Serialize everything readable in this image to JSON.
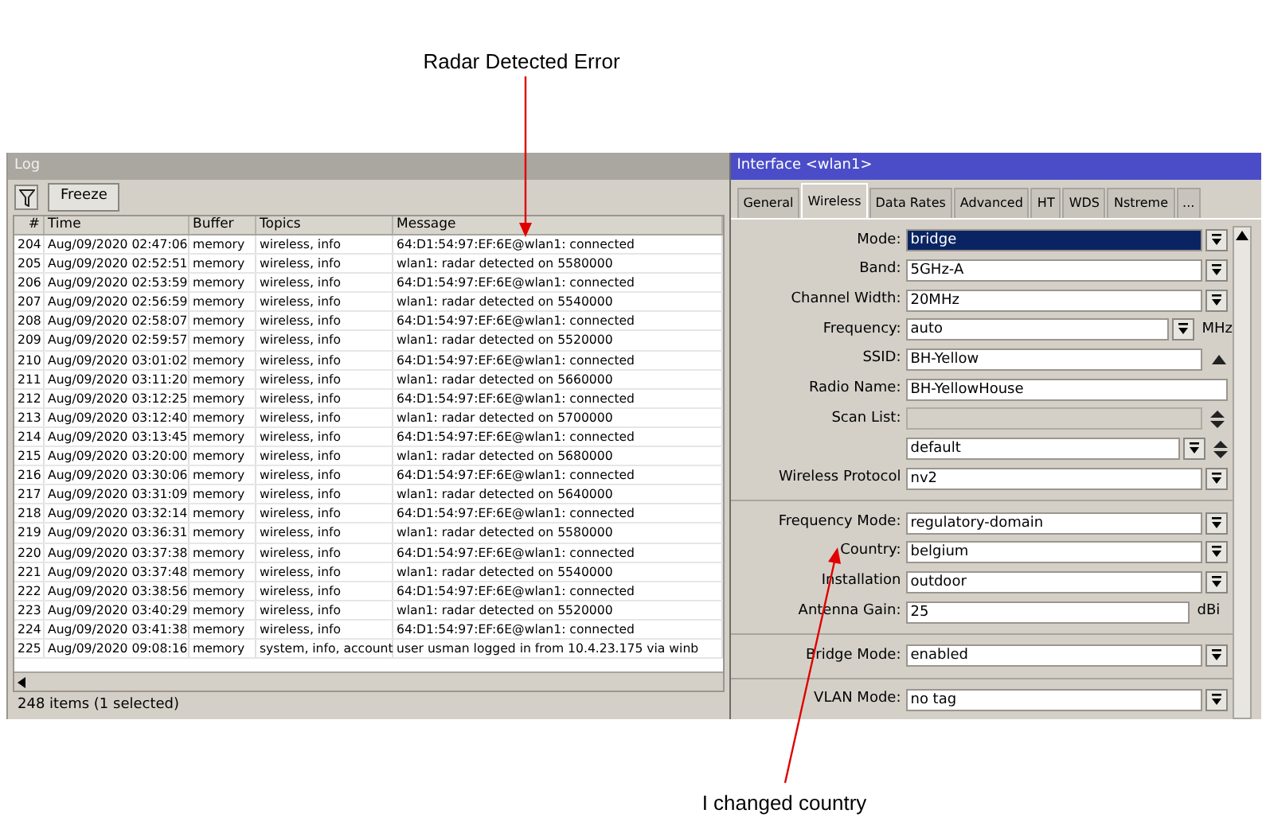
{
  "annotations": [
    {
      "text": "Radar Detected Error"
    },
    {
      "text": "I changed country"
    }
  ],
  "log": {
    "title": "Log",
    "freeze_button": "Freeze",
    "columns": [
      "#",
      "Time",
      "Buffer",
      "Topics",
      "Message"
    ],
    "rows": [
      {
        "n": "204",
        "time": "Aug/09/2020 02:47:06",
        "buffer": "memory",
        "topics": "wireless, info",
        "message": "64:D1:54:97:EF:6E@wlan1: connected"
      },
      {
        "n": "205",
        "time": "Aug/09/2020 02:52:51",
        "buffer": "memory",
        "topics": "wireless, info",
        "message": "wlan1: radar detected on 5580000"
      },
      {
        "n": "206",
        "time": "Aug/09/2020 02:53:59",
        "buffer": "memory",
        "topics": "wireless, info",
        "message": "64:D1:54:97:EF:6E@wlan1: connected"
      },
      {
        "n": "207",
        "time": "Aug/09/2020 02:56:59",
        "buffer": "memory",
        "topics": "wireless, info",
        "message": "wlan1: radar detected on 5540000"
      },
      {
        "n": "208",
        "time": "Aug/09/2020 02:58:07",
        "buffer": "memory",
        "topics": "wireless, info",
        "message": "64:D1:54:97:EF:6E@wlan1: connected"
      },
      {
        "n": "209",
        "time": "Aug/09/2020 02:59:57",
        "buffer": "memory",
        "topics": "wireless, info",
        "message": "wlan1: radar detected on 5520000"
      },
      {
        "n": "210",
        "time": "Aug/09/2020 03:01:02",
        "buffer": "memory",
        "topics": "wireless, info",
        "message": "64:D1:54:97:EF:6E@wlan1: connected"
      },
      {
        "n": "211",
        "time": "Aug/09/2020 03:11:20",
        "buffer": "memory",
        "topics": "wireless, info",
        "message": "wlan1: radar detected on 5660000"
      },
      {
        "n": "212",
        "time": "Aug/09/2020 03:12:25",
        "buffer": "memory",
        "topics": "wireless, info",
        "message": "64:D1:54:97:EF:6E@wlan1: connected"
      },
      {
        "n": "213",
        "time": "Aug/09/2020 03:12:40",
        "buffer": "memory",
        "topics": "wireless, info",
        "message": "wlan1: radar detected on 5700000"
      },
      {
        "n": "214",
        "time": "Aug/09/2020 03:13:45",
        "buffer": "memory",
        "topics": "wireless, info",
        "message": "64:D1:54:97:EF:6E@wlan1: connected"
      },
      {
        "n": "215",
        "time": "Aug/09/2020 03:20:00",
        "buffer": "memory",
        "topics": "wireless, info",
        "message": "wlan1: radar detected on 5680000"
      },
      {
        "n": "216",
        "time": "Aug/09/2020 03:30:06",
        "buffer": "memory",
        "topics": "wireless, info",
        "message": "64:D1:54:97:EF:6E@wlan1: connected"
      },
      {
        "n": "217",
        "time": "Aug/09/2020 03:31:09",
        "buffer": "memory",
        "topics": "wireless, info",
        "message": "wlan1: radar detected on 5640000"
      },
      {
        "n": "218",
        "time": "Aug/09/2020 03:32:14",
        "buffer": "memory",
        "topics": "wireless, info",
        "message": "64:D1:54:97:EF:6E@wlan1: connected"
      },
      {
        "n": "219",
        "time": "Aug/09/2020 03:36:31",
        "buffer": "memory",
        "topics": "wireless, info",
        "message": "wlan1: radar detected on 5580000"
      },
      {
        "n": "220",
        "time": "Aug/09/2020 03:37:38",
        "buffer": "memory",
        "topics": "wireless, info",
        "message": "64:D1:54:97:EF:6E@wlan1: connected"
      },
      {
        "n": "221",
        "time": "Aug/09/2020 03:37:48",
        "buffer": "memory",
        "topics": "wireless, info",
        "message": "wlan1: radar detected on 5540000"
      },
      {
        "n": "222",
        "time": "Aug/09/2020 03:38:56",
        "buffer": "memory",
        "topics": "wireless, info",
        "message": "64:D1:54:97:EF:6E@wlan1: connected"
      },
      {
        "n": "223",
        "time": "Aug/09/2020 03:40:29",
        "buffer": "memory",
        "topics": "wireless, info",
        "message": "wlan1: radar detected on 5520000"
      },
      {
        "n": "224",
        "time": "Aug/09/2020 03:41:38",
        "buffer": "memory",
        "topics": "wireless, info",
        "message": "64:D1:54:97:EF:6E@wlan1: connected"
      },
      {
        "n": "225",
        "time": "Aug/09/2020 09:08:16",
        "buffer": "memory",
        "topics": "system, info, account",
        "message": "user usman logged in from 10.4.23.175 via winb"
      }
    ],
    "status": "248 items (1 selected)"
  },
  "interface": {
    "title": "Interface <wlan1>",
    "tabs": [
      {
        "label": "General",
        "selected": false
      },
      {
        "label": "Wireless",
        "selected": true
      },
      {
        "label": "Data Rates",
        "selected": false
      },
      {
        "label": "Advanced",
        "selected": false
      },
      {
        "label": "HT",
        "selected": false
      },
      {
        "label": "WDS",
        "selected": false
      },
      {
        "label": "Nstreme",
        "selected": false
      },
      {
        "label": "...",
        "selected": false
      }
    ],
    "sections": [
      {
        "fields": [
          {
            "kind": "select",
            "label": "Mode:",
            "value": "bridge",
            "selected": true
          },
          {
            "kind": "select",
            "label": "Band:",
            "value": "5GHz-A",
            "selected": false
          },
          {
            "kind": "select",
            "label": "Channel Width:",
            "value": "20MHz",
            "selected": false
          },
          {
            "kind": "select",
            "label": "Frequency:",
            "value": "auto",
            "unit": "MHz",
            "selected": false
          },
          {
            "kind": "collapse",
            "label": "SSID:",
            "value": "BH-Yellow",
            "selected": false
          },
          {
            "kind": "input",
            "label": "Radio Name:",
            "value": "BH-YellowHouse",
            "selected": false
          },
          {
            "kind": "list",
            "label": "Scan List:",
            "selected": false
          },
          {
            "kind": "listselect",
            "value": "default",
            "selected": false
          },
          {
            "kind": "select",
            "label": "Wireless Protocol",
            "value": "nv2",
            "selected": false
          }
        ]
      },
      {
        "fields": [
          {
            "kind": "select",
            "label": "Frequency Mode:",
            "value": "regulatory-domain",
            "selected": false
          },
          {
            "kind": "select",
            "label": "Country:",
            "value": "belgium",
            "selected": false
          },
          {
            "kind": "select",
            "label": "Installation",
            "value": "outdoor",
            "selected": false
          },
          {
            "kind": "input",
            "label": "Antenna Gain:",
            "value": "25",
            "unit": "dBi",
            "selected": false
          }
        ]
      },
      {
        "fields": [
          {
            "kind": "select",
            "label": "Bridge Mode:",
            "value": "enabled",
            "selected": false
          }
        ]
      },
      {
        "fields": [
          {
            "kind": "select",
            "label": "VLAN Mode:",
            "value": "no tag",
            "selected": false
          }
        ]
      }
    ]
  }
}
